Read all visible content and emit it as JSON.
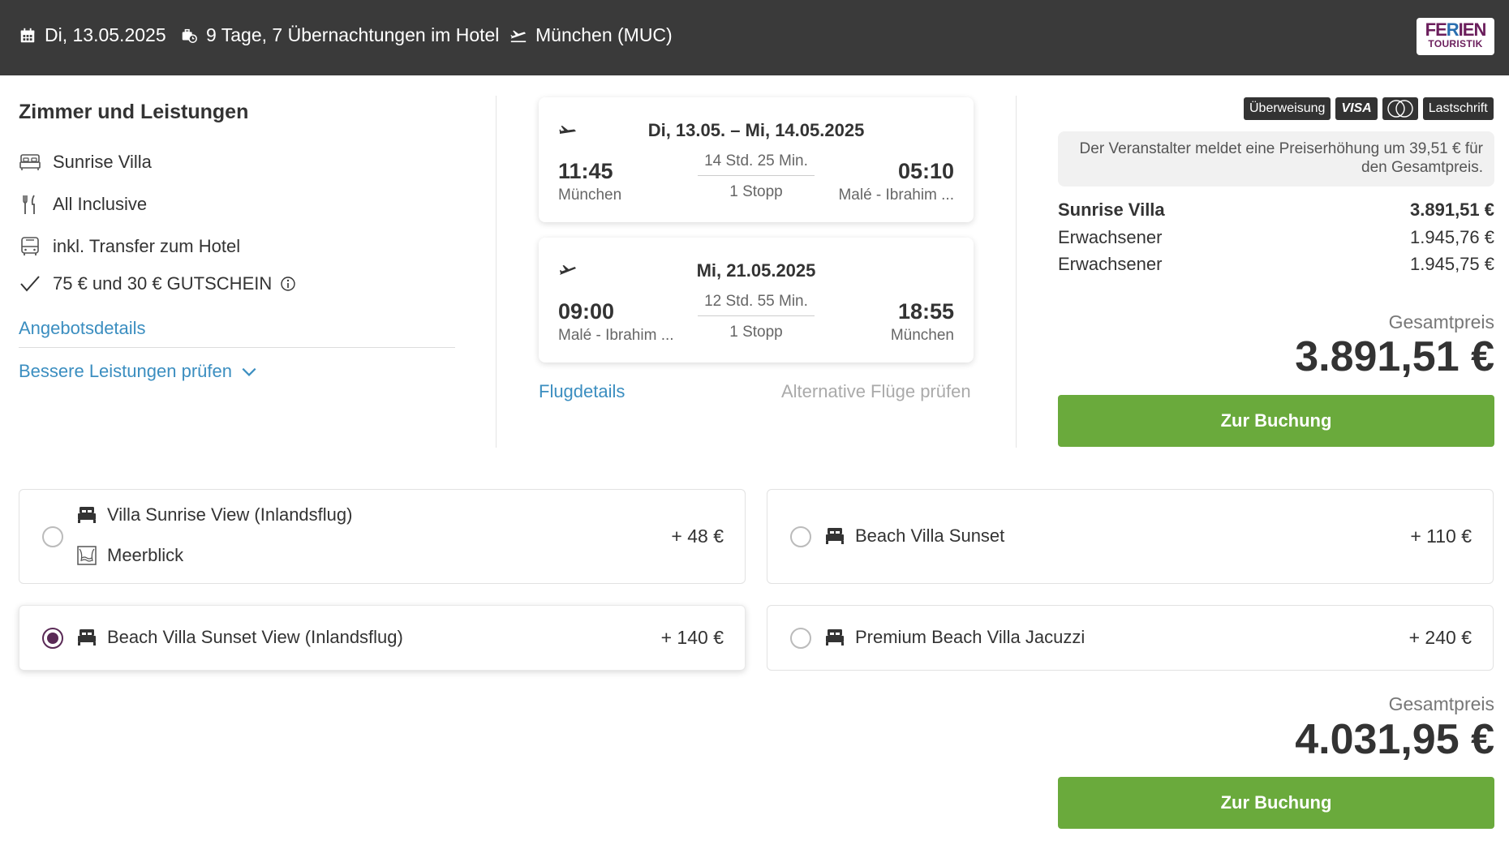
{
  "header": {
    "date": "Di, 13.05.2025",
    "duration": "9 Tage, 7 Übernachtungen im Hotel",
    "airport": "München (MUC)",
    "logo_line1": "FERIEN",
    "logo_line2": "TOURISTIK"
  },
  "services": {
    "title": "Zimmer und Leistungen",
    "room": "Sunrise Villa",
    "board": "All Inclusive",
    "transfer": "inkl. Transfer zum Hotel",
    "voucher": "75 € und 30 € GUTSCHEIN",
    "offer_details_link": "Angebotsdetails",
    "better_services_link": "Bessere Leistungen prüfen"
  },
  "flights": {
    "outbound": {
      "date": "Di, 13.05. – Mi, 14.05.2025",
      "dep_time": "11:45",
      "dep_place": "München",
      "duration": "14 Std. 25 Min.",
      "stops": "1 Stopp",
      "arr_time": "05:10",
      "arr_place": "Malé - Ibrahim ..."
    },
    "return": {
      "date": "Mi, 21.05.2025",
      "dep_time": "09:00",
      "dep_place": "Malé - Ibrahim ...",
      "duration": "12 Std. 55 Min.",
      "stops": "1 Stopp",
      "arr_time": "18:55",
      "arr_place": "München"
    },
    "details_link": "Flugdetails",
    "alternatives_link": "Alternative Flüge prüfen"
  },
  "payment_methods": [
    "Überweisung",
    "VISA",
    "MasterCard",
    "Lastschrift"
  ],
  "price_notice": "Der Veranstalter meldet eine Preiserhöhung um 39,51 € für den Gesamtpreis.",
  "price_breakdown": [
    {
      "label": "Sunrise Villa",
      "value": "3.891,51 €"
    },
    {
      "label": "Erwachsener",
      "value": "1.945,76 €"
    },
    {
      "label": "Erwachsener",
      "value": "1.945,75 €"
    }
  ],
  "total": {
    "label": "Gesamtpreis",
    "value": "3.891,51 €",
    "button": "Zur Buchung"
  },
  "room_options": [
    {
      "name": "Villa Sunrise View (Inlandsflug)",
      "extra": "Meerblick",
      "price": "+  48 €",
      "selected": false
    },
    {
      "name": "Beach Villa Sunset",
      "price": "+  110 €",
      "selected": false
    },
    {
      "name": "Beach Villa Sunset View (Inlandsflug)",
      "price": "+  140 €",
      "selected": true
    },
    {
      "name": "Premium Beach Villa Jacuzzi",
      "price": "+  240 €",
      "selected": false
    }
  ],
  "option_total": {
    "label": "Gesamtpreis",
    "value": "4.031,95 €",
    "button": "Zur Buchung"
  },
  "colors": {
    "header_bg": "#3a3a3a",
    "link": "#3b8ec0",
    "button": "#6aaa3c",
    "radio_selected": "#5a2a56",
    "logo": "#6b1e5c"
  }
}
